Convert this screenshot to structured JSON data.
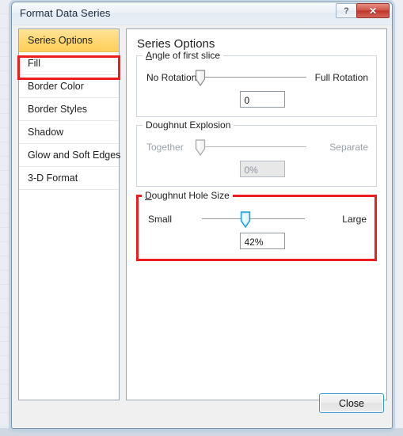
{
  "window": {
    "title": "Format Data Series",
    "help_button": "?",
    "close_button": "✕"
  },
  "sidebar": {
    "items": [
      {
        "label": "Series Options",
        "selected": true
      },
      {
        "label": "Fill",
        "selected": false
      },
      {
        "label": "Border Color",
        "selected": false
      },
      {
        "label": "Border Styles",
        "selected": false
      },
      {
        "label": "Shadow",
        "selected": false
      },
      {
        "label": "Glow and Soft Edges",
        "selected": false
      },
      {
        "label": "3-D Format",
        "selected": false
      }
    ],
    "highlight_color": "#ee1c1c",
    "selected_color": "#ffd873"
  },
  "content": {
    "heading": "Series Options",
    "groups": {
      "angle_of_first_slice": {
        "legend_accel": "A",
        "legend_rest": "ngle of first slice",
        "left_label": "No Rotation",
        "right_label": "Full Rotation",
        "value": "0",
        "slider_percent": 0,
        "enabled": true
      },
      "doughnut_explosion": {
        "legend": "Doughnut Explosion",
        "left_label": "Together",
        "right_label": "Separate",
        "value": "0%",
        "slider_percent": 0,
        "enabled": false
      },
      "doughnut_hole_size": {
        "legend_accel": "D",
        "legend_rest": "oughnut Hole Size",
        "left_label": "Small",
        "right_label": "Large",
        "value": "42%",
        "slider_percent": 42,
        "enabled": true,
        "highlighted": true,
        "highlight_color": "#ee1c1c"
      }
    }
  },
  "footer": {
    "close_label": "Close"
  }
}
